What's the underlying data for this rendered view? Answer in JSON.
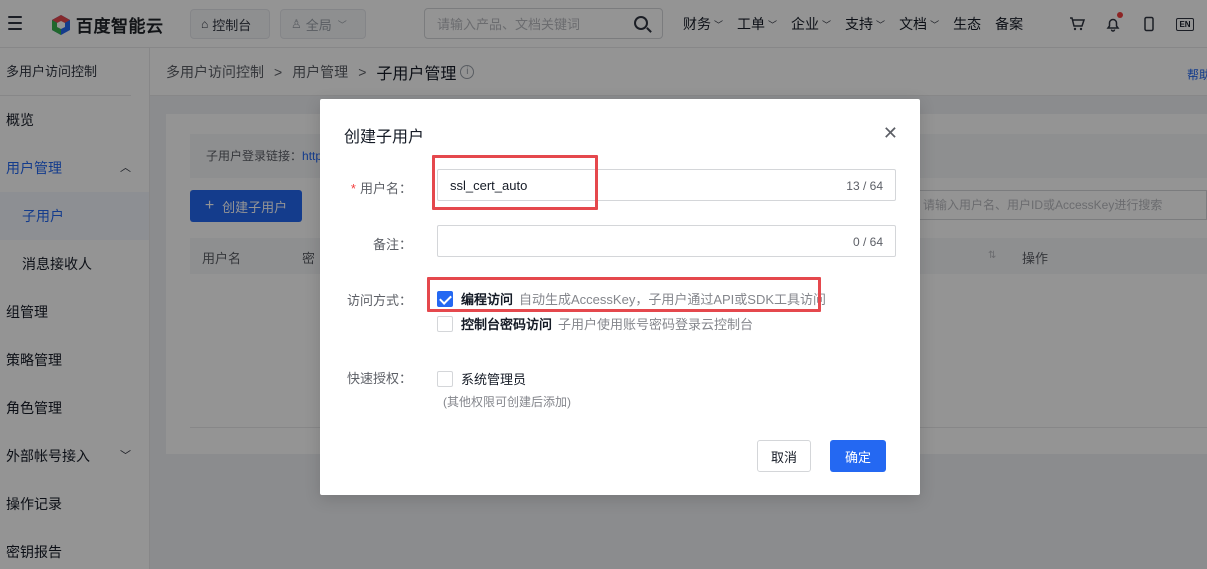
{
  "topnav": {
    "logo_text": "百度智能云",
    "console_label": "控制台",
    "region_label": "全局",
    "search_placeholder": "请输入产品、文档关键词",
    "nav": [
      {
        "label": "财务",
        "caret": true
      },
      {
        "label": "工单",
        "caret": true
      },
      {
        "label": "企业",
        "caret": true
      },
      {
        "label": "支持",
        "caret": true
      },
      {
        "label": "文档",
        "caret": true
      },
      {
        "label": "生态",
        "caret": false
      },
      {
        "label": "备案",
        "caret": false
      }
    ],
    "lang_label": "EN"
  },
  "sidebar": {
    "title": "多用户访问控制",
    "items": [
      {
        "label": "概览"
      },
      {
        "label": "用户管理"
      },
      {
        "label": "子用户"
      },
      {
        "label": "消息接收人"
      },
      {
        "label": "组管理"
      },
      {
        "label": "策略管理"
      },
      {
        "label": "角色管理"
      },
      {
        "label": "外部帐号接入"
      },
      {
        "label": "操作记录"
      },
      {
        "label": "密钥报告"
      }
    ]
  },
  "breadcrumb": {
    "items": [
      "多用户访问控制",
      "用户管理",
      "子用户管理"
    ],
    "help": "帮助"
  },
  "main": {
    "login_link_label": "子用户登录链接：",
    "login_link_value": "http",
    "create_button": "创建子用户",
    "table_search_placeholder": "请输入用户名、用户ID或AccessKey进行搜索",
    "columns": [
      "用户名",
      "密码",
      "操作"
    ]
  },
  "dialog": {
    "title": "创建子用户",
    "username_label": "用户名：",
    "username_value": "ssl_cert_auto",
    "username_count": "13 / 64",
    "remark_label": "备注：",
    "remark_count": "0 / 64",
    "access_label": "访问方式：",
    "access_options": [
      {
        "label": "编程访问",
        "desc": "自动生成AccessKey，子用户通过API或SDK工具访问",
        "checked": true
      },
      {
        "label": "控制台密码访问",
        "desc": "子用户使用账号密码登录云控制台",
        "checked": false
      }
    ],
    "quick_auth_label": "快速授权：",
    "quick_auth_option": "系统管理员",
    "quick_auth_hint": "(其他权限可创建后添加)",
    "cancel": "取消",
    "confirm": "确定"
  }
}
